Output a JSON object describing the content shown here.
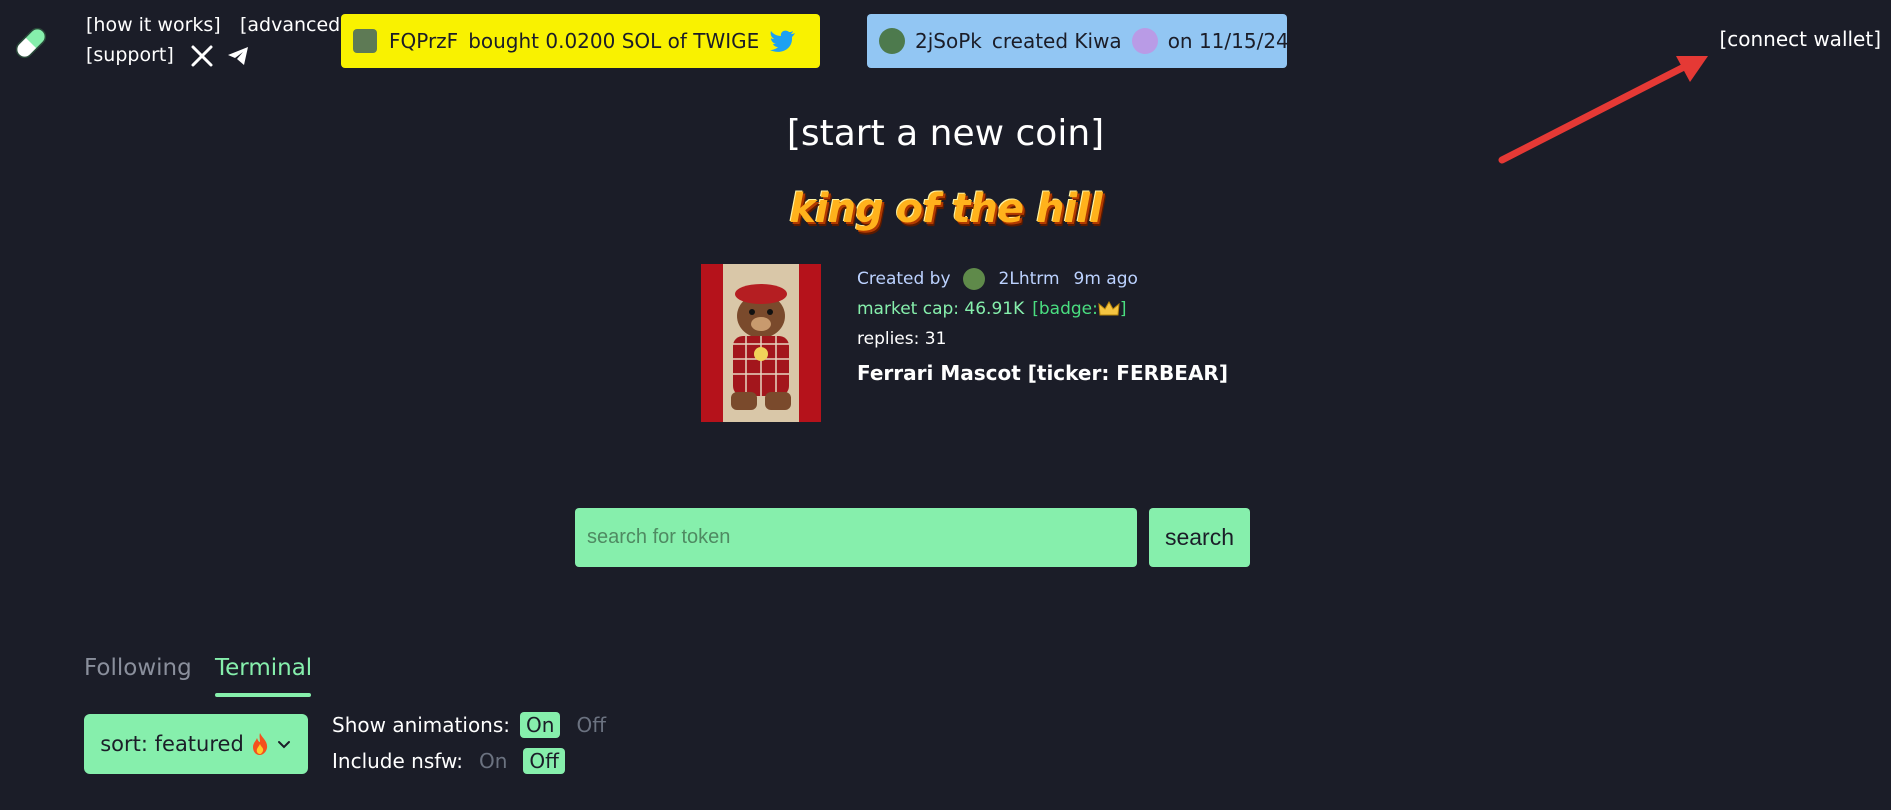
{
  "nav": {
    "how_it_works": "[how it works]",
    "advanced": "[advanced",
    "support": "[support]"
  },
  "tickers": [
    {
      "user": "FQPrzF",
      "action": "bought 0.0200 SOL of TWIGE"
    },
    {
      "user": "2jSoPk",
      "action": "created Kiwa",
      "date": "on 11/15/24"
    }
  ],
  "connect_wallet": "[connect wallet]",
  "start_coin": "[start a new coin]",
  "king_of_the_hill": {
    "title": "king of the hill",
    "created_by_label": "Created by",
    "creator": "2Lhtrm",
    "age": "9m ago",
    "market_cap": "market cap: 46.91K",
    "badge": "[badge:",
    "badge_end": "]",
    "replies": "replies: 31",
    "name": "Ferrari Mascot [ticker: FERBEAR]"
  },
  "search": {
    "placeholder": "search for token",
    "button": "search"
  },
  "tabs": {
    "following": "Following",
    "terminal": "Terminal"
  },
  "sort": {
    "label": "sort: featured"
  },
  "options": {
    "show_animations": "Show animations:",
    "include_nsfw": "Include nsfw:",
    "on": "On",
    "off": "Off"
  },
  "colors": {
    "accent": "#86efac",
    "background": "#1b1d28",
    "ticker_yellow": "#f9f200",
    "ticker_blue": "#92c6f3"
  }
}
